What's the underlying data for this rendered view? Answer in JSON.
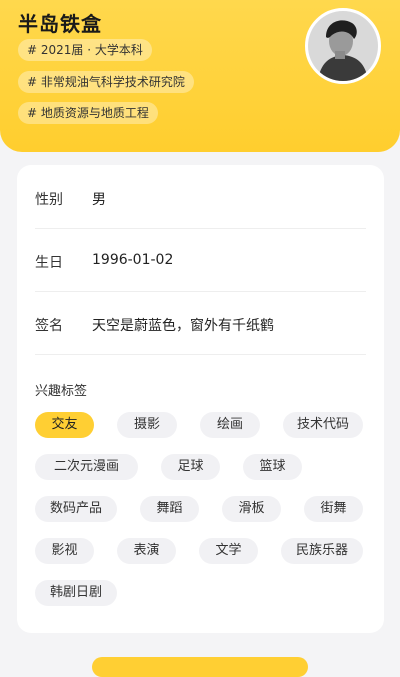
{
  "profile": {
    "name": "半岛铁盒",
    "chips": [
      "# 2021届 · 大学本科",
      "# 非常规油气科学技术研究院",
      "# 地质资源与地质工程"
    ]
  },
  "info": [
    {
      "label": "性别",
      "value": "男"
    },
    {
      "label": "生日",
      "value": "1996-01-02"
    },
    {
      "label": "签名",
      "value": "天空是蔚蓝色，窗外有千纸鹤"
    }
  ],
  "interests": {
    "title": "兴趣标签",
    "tags": [
      "交友",
      "摄影",
      "绘画",
      "技术代码",
      "二次元漫画",
      "足球",
      "篮球",
      "数码产品",
      "舞蹈",
      "滑板",
      "街舞",
      "影视",
      "表演",
      "文学",
      "民族乐器",
      "韩剧日剧"
    ],
    "selected": "交友"
  },
  "colors": {
    "accent": "#ffcf33",
    "background": "#f4f4f6"
  }
}
